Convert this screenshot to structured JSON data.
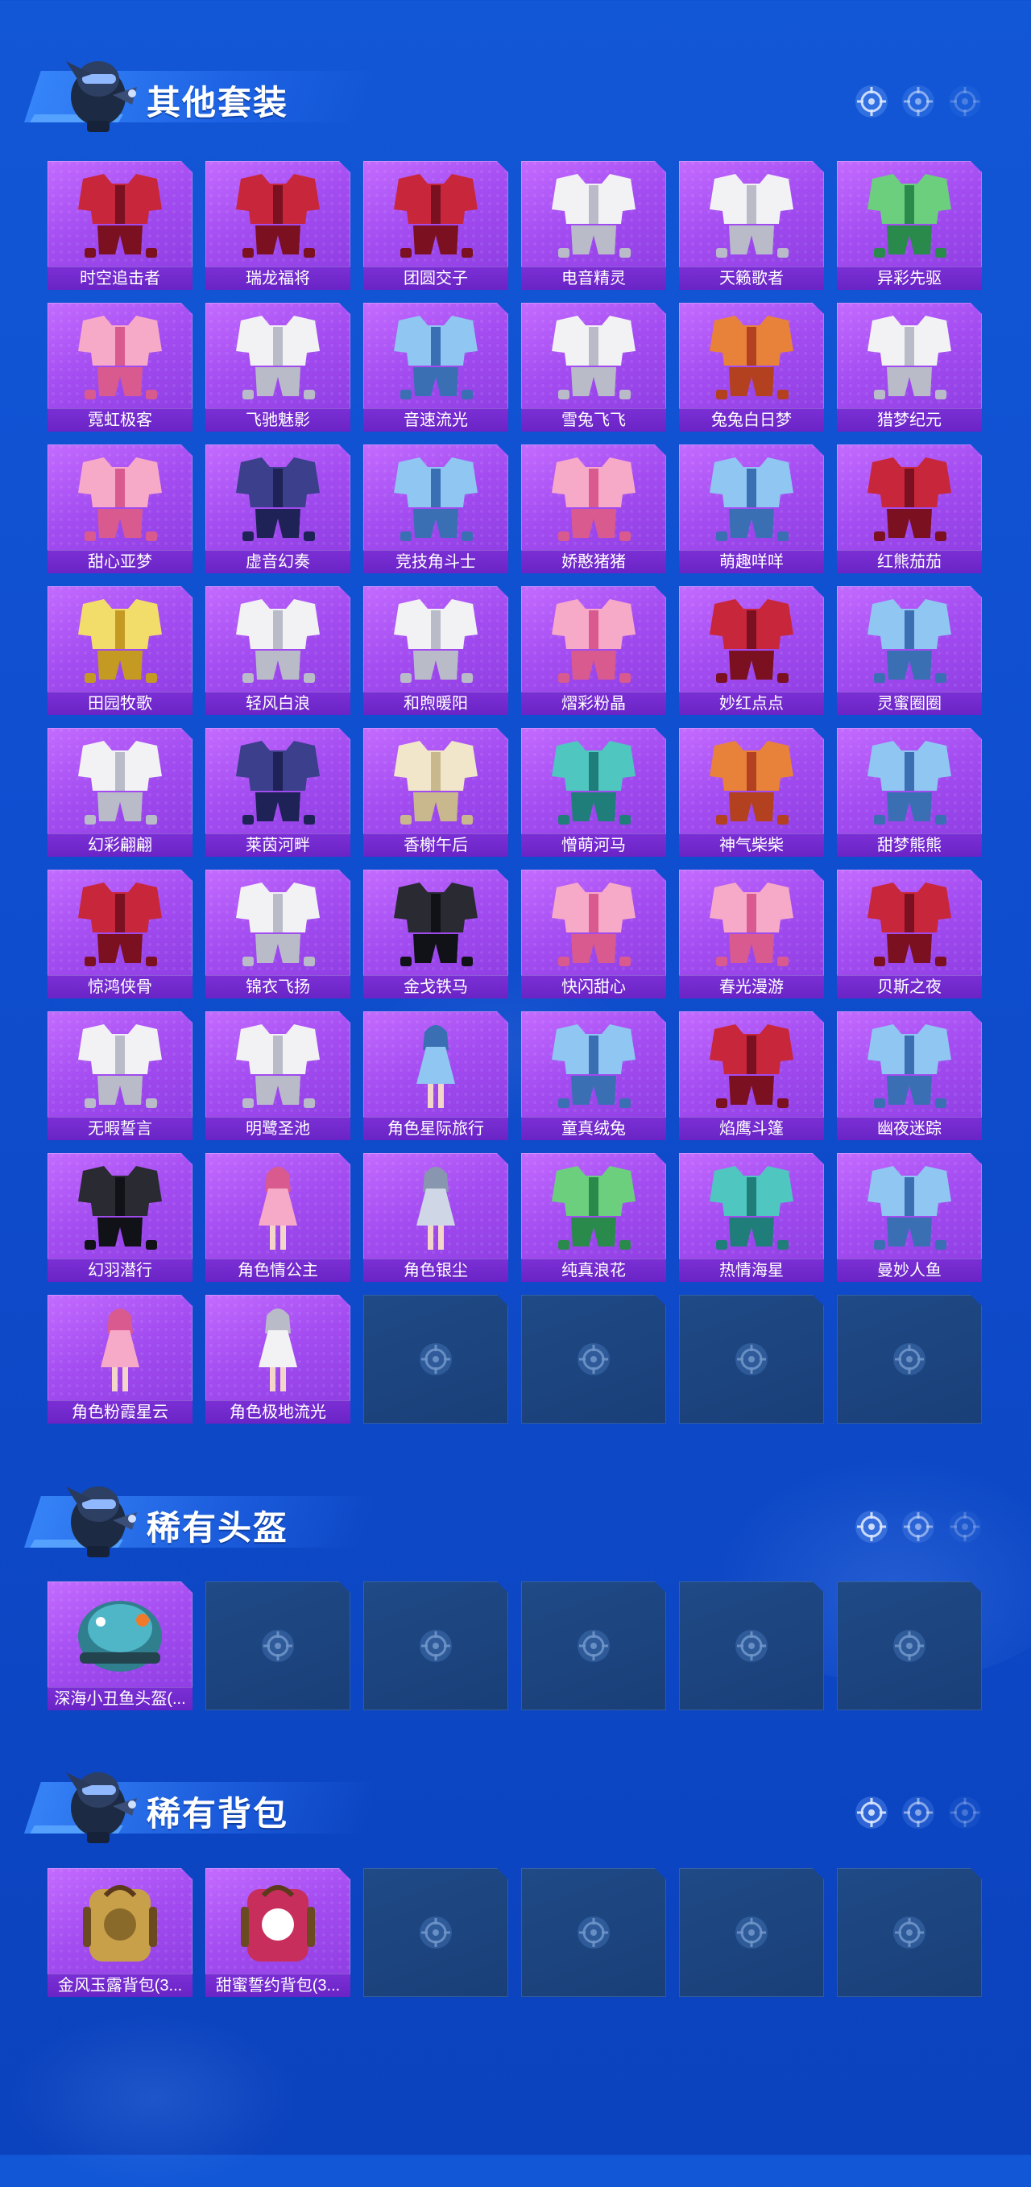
{
  "colors": {
    "background": "#0f4fd0",
    "card_purple": "#a34cf1",
    "card_label": "#6a24c6",
    "card_empty": "#1f4a86"
  },
  "sections": [
    {
      "title": "其他套装",
      "items": [
        {
          "name": "时空追击者",
          "art": "suit-red-mech"
        },
        {
          "name": "瑞龙福将",
          "art": "suit-red-armor"
        },
        {
          "name": "团圆交子",
          "art": "suit-red-orange"
        },
        {
          "name": "电音精灵",
          "art": "suit-dark-coat"
        },
        {
          "name": "天籁歌者",
          "art": "suit-white"
        },
        {
          "name": "异彩先驱",
          "art": "suit-purple-green"
        },
        {
          "name": "霓虹极客",
          "art": "suit-teal-pink"
        },
        {
          "name": "飞驰魅影",
          "art": "suit-gold-white"
        },
        {
          "name": "音速流光",
          "art": "suit-silver-blue"
        },
        {
          "name": "雪兔飞飞",
          "art": "suit-white-black"
        },
        {
          "name": "兔兔白日梦",
          "art": "suit-white-orange"
        },
        {
          "name": "猎梦纪元",
          "art": "suit-cow-print"
        },
        {
          "name": "甜心亚梦",
          "art": "suit-black-pink"
        },
        {
          "name": "虚音幻奏",
          "art": "suit-navy-plaid"
        },
        {
          "name": "竞技角斗士",
          "art": "suit-blue-gold"
        },
        {
          "name": "娇憨猪猪",
          "art": "suit-pink"
        },
        {
          "name": "萌趣咩咩",
          "art": "suit-light-blue"
        },
        {
          "name": "红熊茄茄",
          "art": "suit-red-bear"
        },
        {
          "name": "田园牧歌",
          "art": "suit-cream-yellow"
        },
        {
          "name": "轻风白浪",
          "art": "suit-white-blue"
        },
        {
          "name": "和煦暖阳",
          "art": "suit-pink-white"
        },
        {
          "name": "熠彩粉晶",
          "art": "suit-pink-dress"
        },
        {
          "name": "妙红点点",
          "art": "suit-red-dots"
        },
        {
          "name": "灵蜜圈圈",
          "art": "suit-yellow-blue"
        },
        {
          "name": "幻彩翩翩",
          "art": "suit-pastel"
        },
        {
          "name": "莱茵河畔",
          "art": "suit-navy-school"
        },
        {
          "name": "香榭午后",
          "art": "suit-cream"
        },
        {
          "name": "憎萌河马",
          "art": "suit-teal-hippo"
        },
        {
          "name": "神气柴柴",
          "art": "suit-orange-dog"
        },
        {
          "name": "甜梦熊熊",
          "art": "suit-blue-bear"
        },
        {
          "name": "惊鸿侠骨",
          "art": "suit-black-red-robe"
        },
        {
          "name": "锦衣飞扬",
          "art": "suit-navy-white-robe"
        },
        {
          "name": "金戈铁马",
          "art": "suit-black-gold"
        },
        {
          "name": "快闪甜心",
          "art": "suit-black-pink-jacket"
        },
        {
          "name": "春光漫游",
          "art": "suit-pink-black"
        },
        {
          "name": "贝斯之夜",
          "art": "suit-white-red"
        },
        {
          "name": "无暇誓言",
          "art": "suit-white-wedding"
        },
        {
          "name": "明鹭圣池",
          "art": "suit-white-gold-gown"
        },
        {
          "name": "角色星际旅行",
          "art": "char-blue-idol"
        },
        {
          "name": "童真绒兔",
          "art": "suit-blue-rabbit"
        },
        {
          "name": "焰鹰斗篷",
          "art": "suit-dark-red-cloak"
        },
        {
          "name": "幽夜迷踪",
          "art": "suit-dark-blue"
        },
        {
          "name": "幻羽潜行",
          "art": "suit-black-green"
        },
        {
          "name": "角色情公主",
          "art": "char-pink-princess"
        },
        {
          "name": "角色银尘",
          "art": "char-silver"
        },
        {
          "name": "纯真浪花",
          "art": "suit-green-wave"
        },
        {
          "name": "热情海星",
          "art": "suit-teal-starfish"
        },
        {
          "name": "曼妙人鱼",
          "art": "suit-blue-mermaid"
        },
        {
          "name": "角色粉霞星云",
          "art": "char-pink-nebula"
        },
        {
          "name": "角色极地流光",
          "art": "char-polar"
        }
      ],
      "empty_slots": 4
    },
    {
      "title": "稀有头盔",
      "items": [
        {
          "name": "深海小丑鱼头盔(...",
          "art": "helmet-clownfish"
        }
      ],
      "empty_slots": 5
    },
    {
      "title": "稀有背包",
      "items": [
        {
          "name": "金风玉露背包(3...",
          "art": "backpack-gold"
        },
        {
          "name": "甜蜜誓约背包(3...",
          "art": "backpack-heart"
        }
      ],
      "empty_slots": 4
    }
  ]
}
